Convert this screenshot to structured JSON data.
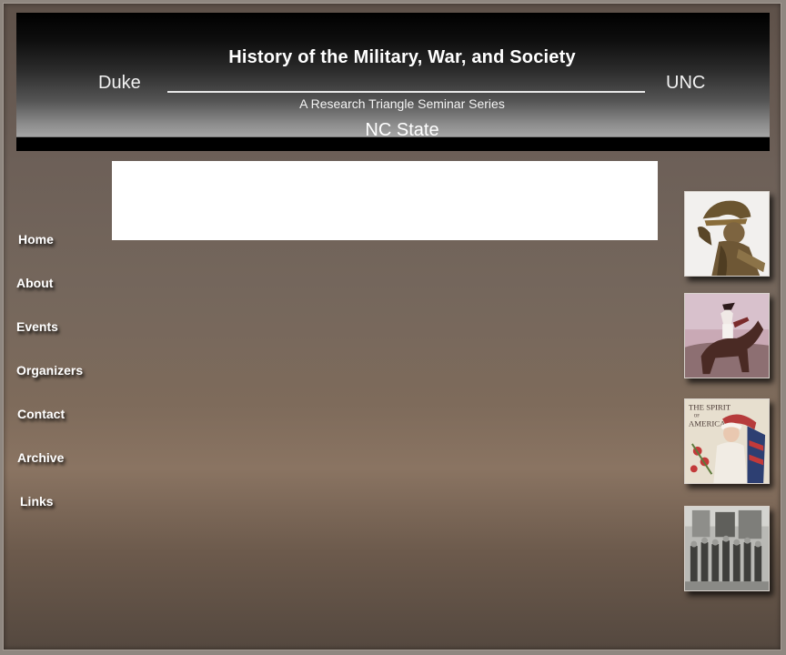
{
  "banner": {
    "title": "History of the Military, War, and Society",
    "left": "Duke",
    "right": "UNC",
    "subtitle": "A Research Triangle Seminar Series",
    "bottom": "NC State"
  },
  "nav": {
    "items": [
      {
        "label": "Home"
      },
      {
        "label": "About"
      },
      {
        "label": "Events"
      },
      {
        "label": "Organizers"
      },
      {
        "label": "Contact"
      },
      {
        "label": "Archive"
      },
      {
        "label": "Links"
      }
    ]
  },
  "thumbnails": [
    {
      "name": "helmeted-warrior-statue-image"
    },
    {
      "name": "napoleon-on-horseback-image"
    },
    {
      "name": "spirit-of-america-poster-image",
      "caption": "THE SPIRIT OF AMERICA"
    },
    {
      "name": "soldiers-group-photo-image"
    }
  ]
}
